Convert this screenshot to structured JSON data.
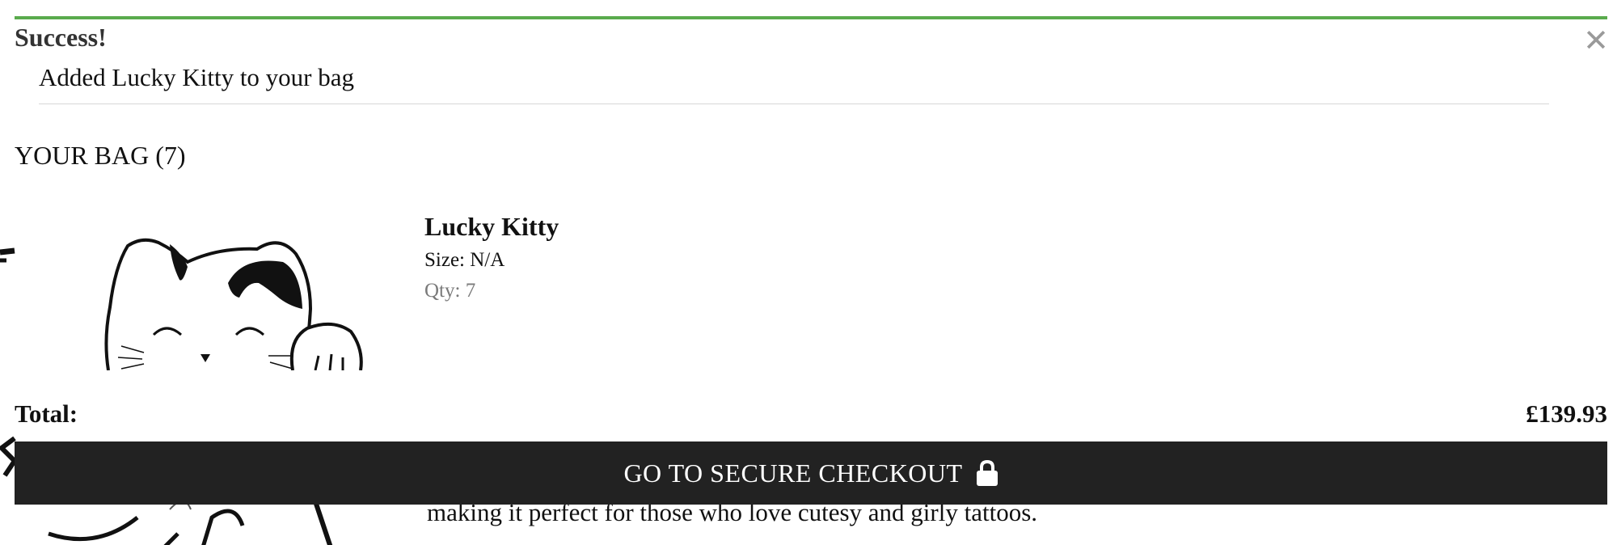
{
  "notification": {
    "title": "Success!",
    "message": "Added Lucky Kitty to your bag",
    "accent_color": "#5aab4d"
  },
  "bag": {
    "title": "YOUR BAG (7)",
    "items": [
      {
        "name": "Lucky Kitty",
        "size": "Size: N/A",
        "qty": "Qty: 7",
        "image_icon": "lucky-cat-icon"
      }
    ],
    "total_label": "Total:",
    "total_value": "£139.93",
    "checkout_label": "GO TO SECURE CHECKOUT",
    "checkout_icon": "lock-icon",
    "close_icon": "close-icon"
  },
  "background_page": {
    "description_fragment": "making it perfect for those who love cutesy and girly tattoos."
  },
  "colors": {
    "checkout_bg": "#222222",
    "qty_text": "#7a7a7a",
    "close_icon": "#9a9a9a"
  }
}
